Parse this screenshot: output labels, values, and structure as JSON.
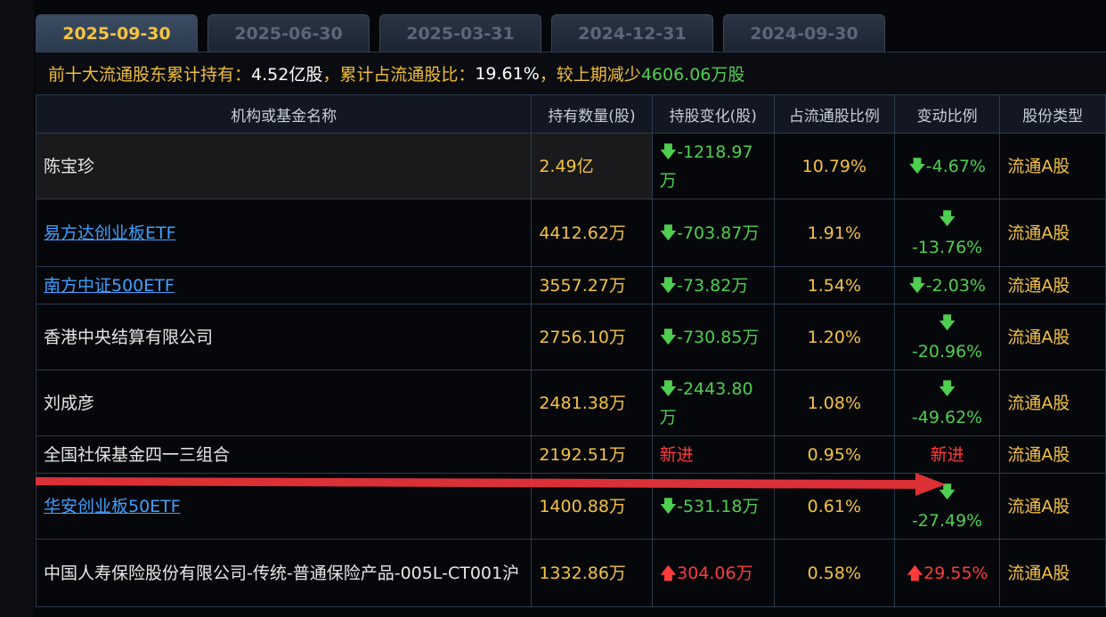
{
  "tabs": [
    "2025-09-30",
    "2025-06-30",
    "2025-03-31",
    "2024-12-31",
    "2024-09-30"
  ],
  "summary": {
    "label1": "前十大流通股东累计持有：",
    "value1": "4.52亿股",
    "label2": "，累计占流通股比：",
    "value2": "19.61%",
    "label3": "，较上期减少",
    "change": "4606.06万股"
  },
  "columns": [
    "机构或基金名称",
    "持有数量(股)",
    "持股变化(股)",
    "占流通股比例",
    "变动比例",
    "股份类型"
  ],
  "rows": [
    {
      "name": "陈宝珍",
      "link": false,
      "qty": "2.49亿",
      "chg_arrow": "🡇",
      "chg": "-1218.97万",
      "ratio": "10.79%",
      "pct_arrow": "🡇",
      "pct": "-4.67%",
      "type": "流通A股"
    },
    {
      "name": "易方达创业板ETF",
      "link": true,
      "qty": "4412.62万",
      "chg_arrow": "🡇",
      "chg": "-703.87万",
      "ratio": "1.91%",
      "pct_arrow": "🡇",
      "pct": " -13.76%",
      "type": "流通A股"
    },
    {
      "name": "南方中证500ETF",
      "link": true,
      "qty": "3557.27万",
      "chg_arrow": "🡇",
      "chg": "-73.82万",
      "ratio": "1.54%",
      "pct_arrow": "🡇",
      "pct": "-2.03%",
      "type": "流通A股"
    },
    {
      "name": "香港中央结算有限公司",
      "link": false,
      "qty": "2756.10万",
      "chg_arrow": "🡇",
      "chg": "-730.85万",
      "ratio": "1.20%",
      "pct_arrow": "🡇",
      "pct": " -20.96%",
      "type": "流通A股"
    },
    {
      "name": "刘成彦",
      "link": false,
      "qty": "2481.38万",
      "chg_arrow": "🡇",
      "chg": "-2443.80万",
      "ratio": "1.08%",
      "pct_arrow": "🡇",
      "pct": " -49.62%",
      "type": "流通A股"
    },
    {
      "name": "全国社保基金四一三组合",
      "link": false,
      "qty": "2192.51万",
      "chg_arrow": "",
      "chg": "新进",
      "ratio": "0.95%",
      "pct_arrow": "",
      "pct": "新进",
      "type": "流通A股"
    },
    {
      "name": "华安创业板50ETF",
      "link": true,
      "qty": "1400.88万",
      "chg_arrow": "🡇",
      "chg": "-531.18万",
      "ratio": "0.61%",
      "pct_arrow": "🡇",
      "pct": " -27.49%",
      "type": "流通A股"
    },
    {
      "name": "中国人寿保险股份有限公司-传统-普通保险产品-005L-CT001沪",
      "link": false,
      "qty": "1332.86万",
      "chg_arrow": "🡅",
      "chg": "304.06万",
      "ratio": "0.58%",
      "pct_arrow": "🡅",
      "pct": "29.55%",
      "type": "流通A股"
    }
  ],
  "colors": {
    "gold": "#f5c243",
    "green": "#4fce4f",
    "red": "#ff3b3b",
    "link": "#3fa0ff",
    "annotation_arrow": "#e8333a"
  }
}
